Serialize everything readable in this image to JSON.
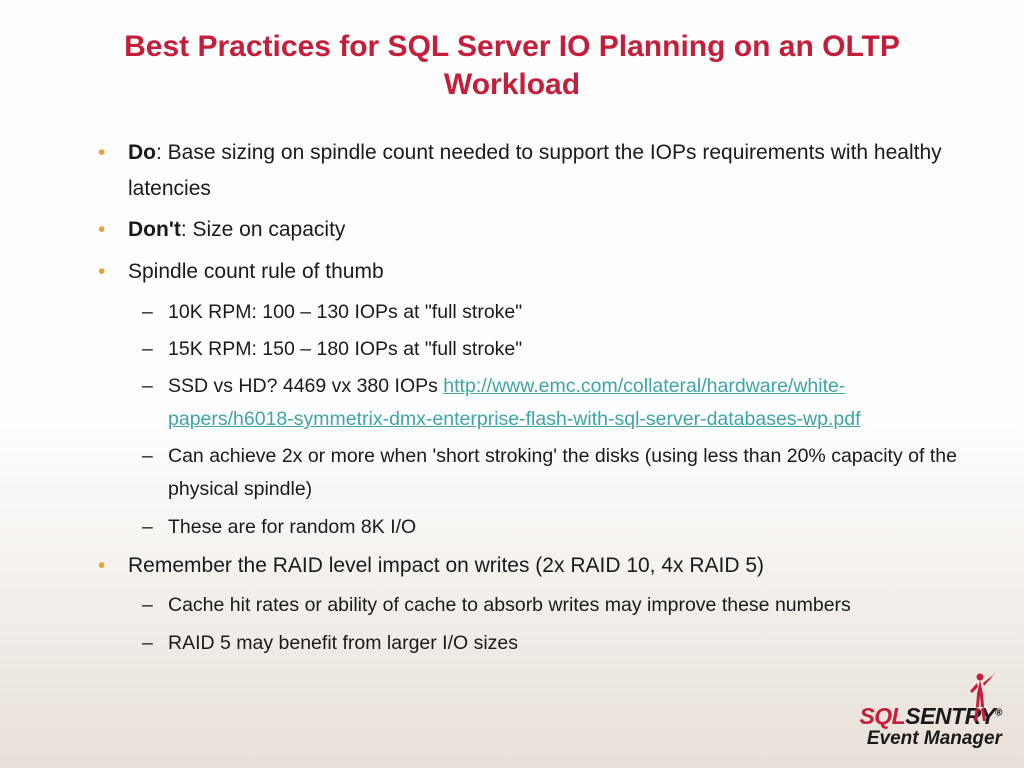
{
  "title": "Best Practices for SQL Server IO Planning on an OLTP Workload",
  "bullets": {
    "b1_lead": "Do",
    "b1_rest": ":  Base sizing on spindle count needed to support the IOPs requirements with healthy latencies",
    "b2_lead": "Don't",
    "b2_rest": ":  Size on capacity",
    "b3": "Spindle count rule of thumb",
    "b3_1": "10K RPM:  100 – 130 IOPs at \"full stroke\"",
    "b3_2": "15K RPM:  150 – 180 IOPs at \"full stroke\"",
    "b3_3_pre": "SSD vs HD? 4469 vx 380 IOPs ",
    "b3_3_link": "http://www.emc.com/collateral/hardware/white-papers/h6018-symmetrix-dmx-enterprise-flash-with-sql-server-databases-wp.pdf",
    "b3_4": "Can achieve 2x or more when 'short stroking' the disks (using less than 20% capacity of the physical spindle)",
    "b3_5": "These are for random 8K I/O",
    "b4": "Remember the RAID level impact on writes (2x RAID 10, 4x RAID 5)",
    "b4_1": "Cache hit rates or ability of cache to absorb writes may improve these numbers",
    "b4_2": "RAID 5 may benefit from larger I/O sizes"
  },
  "logo": {
    "sql": "SQL",
    "sentry": "SENTRY",
    "reg": "®",
    "sub": "Event Manager"
  }
}
